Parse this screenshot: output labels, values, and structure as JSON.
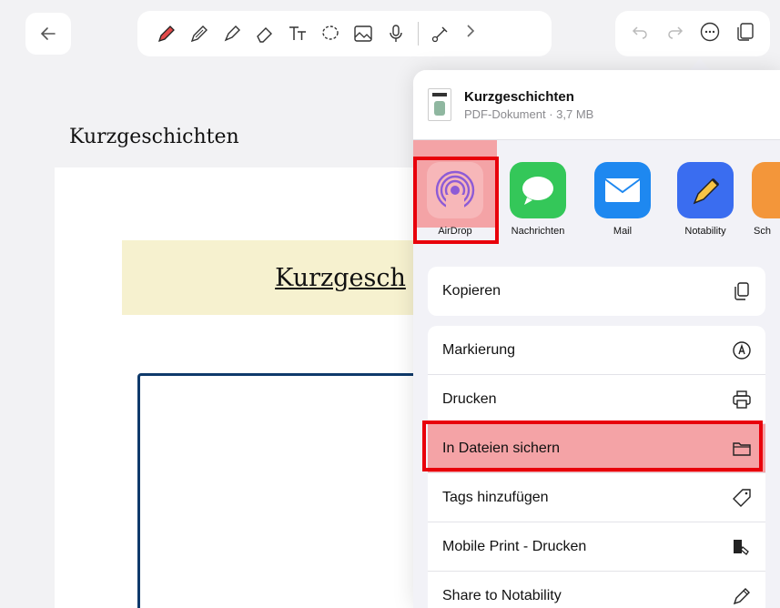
{
  "toolbar": {
    "back_icon": "arrow-left-icon",
    "tools": [
      "pen-red-icon",
      "pencil-icon",
      "highlighter-icon",
      "eraser-icon",
      "text-icon",
      "lasso-icon",
      "image-icon",
      "microphone-icon",
      "link-tool-icon",
      "chevron-right-icon"
    ],
    "right": [
      "undo-icon",
      "redo-icon",
      "more-icon",
      "pages-icon"
    ]
  },
  "document": {
    "title": "Kurzgeschichten",
    "banner_text": "Kurzgesch"
  },
  "share": {
    "file_name": "Kurzgeschichten",
    "file_meta": "PDF-Dokument · 3,7 MB",
    "apps": [
      {
        "label": "AirDrop"
      },
      {
        "label": "Nachrichten"
      },
      {
        "label": "Mail"
      },
      {
        "label": "Notability"
      },
      {
        "label": "Sch"
      }
    ],
    "actions": {
      "copy": "Kopieren",
      "markup": "Markierung",
      "print": "Drucken",
      "save_files": "In Dateien sichern",
      "add_tags": "Tags hinzufügen",
      "mobile_print": "Mobile Print - Drucken",
      "share_notability": "Share to Notability"
    }
  },
  "colors": {
    "highlight_border": "#e8000b",
    "highlight_fill": "#f4a3a6",
    "accent_red_pen": "#e24a4a",
    "messages_green": "#34c759",
    "mail_blue": "#1e88f0",
    "notability_blue": "#3a6df0"
  }
}
